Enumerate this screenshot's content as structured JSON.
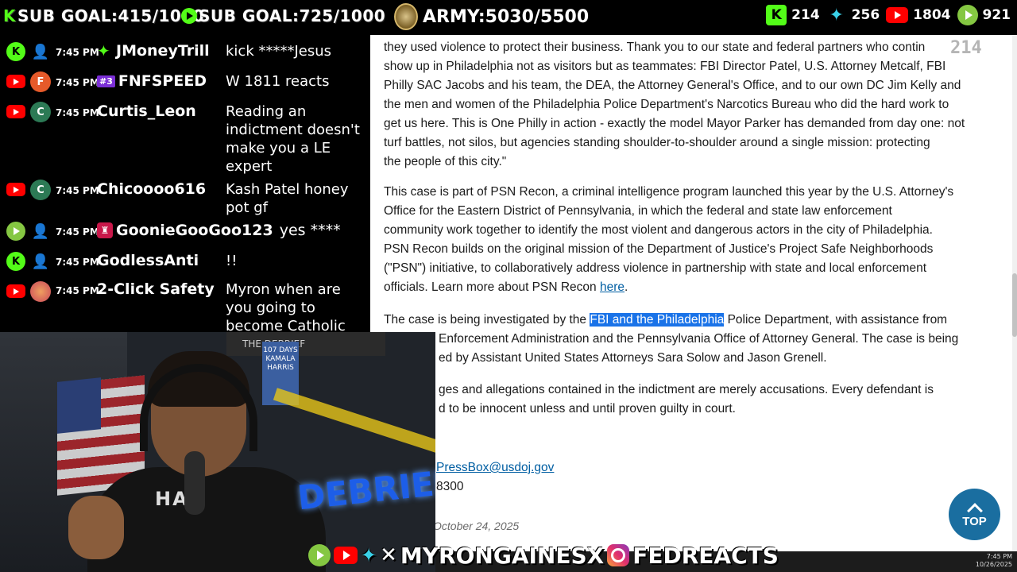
{
  "overlay": {
    "kick_goal": "SUB GOAL:415/1000",
    "kick_letter": "K",
    "rumble_goal": "SUB GOAL:725/1000",
    "army": "ARMY:5030/5500",
    "stats": {
      "kick": "214",
      "wing": "256",
      "youtube": "1804",
      "rumble": "921"
    },
    "social_x": "MYRONGAINESX",
    "social_ig": "FEDREACTS"
  },
  "chat": [
    {
      "platform": "kick",
      "avatar": "",
      "time": "7:45 PM",
      "badge": "kick",
      "badge_text": "",
      "name": "JMoneyTrill",
      "text": "kick *****Jesus"
    },
    {
      "platform": "youtube",
      "avatar": "F",
      "avatar_color": "#e65a2a",
      "time": "7:45 PM",
      "badge": "crown",
      "badge_text": "#3",
      "name": "FNFSPEED",
      "text": "W 1811 reacts"
    },
    {
      "platform": "youtube",
      "avatar": "C",
      "avatar_color": "#2c7a55",
      "time": "7:45 PM",
      "badge": "",
      "badge_text": "",
      "name": "Curtis_Leon",
      "text": "Reading an indictment doesn't make you a LE expert"
    },
    {
      "platform": "youtube",
      "avatar": "C",
      "avatar_color": "#2c7a55",
      "time": "7:45 PM",
      "badge": "",
      "badge_text": "",
      "name": "Chicoooo616",
      "text": "Kash Patel honey pot gf"
    },
    {
      "platform": "rumble",
      "avatar": "",
      "time": "7:45 PM",
      "badge": "rumble",
      "badge_text": "",
      "name": "GoonieGooGoo123",
      "text": "yes ****"
    },
    {
      "platform": "kick",
      "avatar": "",
      "time": "7:45 PM",
      "badge": "",
      "badge_text": "",
      "name": "GodlessAnti",
      "text": "!!"
    },
    {
      "platform": "youtube",
      "avatar": "img",
      "avatar_color": "#c9475a",
      "time": "7:45 PM",
      "badge": "",
      "badge_text": "",
      "name": "2-Click Safety",
      "text": "Myron when are you going to become Catholic"
    }
  ],
  "article": {
    "p1_lines": [
      "they used violence to protect their business. Thank you to our state and federal partners who contin",
      "show up in Philadelphia not as visitors but as teammates: FBI Director Patel, U.S. Attorney Metcalf, FBI",
      "Philly SAC Jacobs and his team, the DEA, the Attorney General's Office, and to our own DC Jim Kelly and",
      "the men and women of the Philadelphia Police Department's Narcotics Bureau who did the hard work to",
      "get us here. This is One Philly in action - exactly the model Mayor Parker has demanded from day one: not",
      "turf battles, not silos, but agencies standing shoulder-to-shoulder around a single mission: protecting",
      "the people of this city.\""
    ],
    "p2_lines": [
      "This case is part of PSN Recon, a criminal intelligence program launched this year by the U.S. Attorney's",
      "Office for the Eastern District of Pennsylvania, in which the federal and state law enforcement",
      "community work together to identify the most violent and dangerous actors in the city of Philadelphia.",
      "PSN Recon builds on the original mission of the Department of Justice's Project Safe Neighborhoods",
      "(\"PSN\") initiative, to collaboratively address violence in partnership with state and local enforcement"
    ],
    "p2_last_prefix": "officials. Learn more about PSN Recon ",
    "p2_link": "here",
    "p2_last_suffix": ".",
    "p3_prefix": "The case is being investigated by the ",
    "p3_highlight": "FBI and the Philadelphia",
    "p3_suffix": " Police Department, with assistance from",
    "p3_line2": "Enforcement Administration and the Pennsylvania Office of Attorney General. The case is being",
    "p3_line3": "ed by Assistant United States Attorneys Sara Solow and Jason Grenell.",
    "p4_line1": "ges and allegations contained in the indictment are merely accusations. Every defendant is",
    "p4_line2": "d to be innocent unless and until proven guilty in court.",
    "contact_email": "PressBox@usdoj.gov",
    "contact_phone": "8300",
    "date": "October 24, 2025",
    "top_label": "TOP",
    "watermark": "214"
  },
  "cam": {
    "poster_text": "107 DAYS KAMALA HARRIS",
    "poster_header": "THE DEBRIEF",
    "hoodie_text": "HAX",
    "sign_text": "DEBRIEF"
  },
  "taskbar": {
    "time": "7:45 PM",
    "date": "10/26/2025"
  },
  "colors": {
    "kick": "#53fc18",
    "youtube": "#ff0000",
    "rumble": "#85c742",
    "highlight": "#1a73e8",
    "top_button": "#1a6ea0"
  }
}
